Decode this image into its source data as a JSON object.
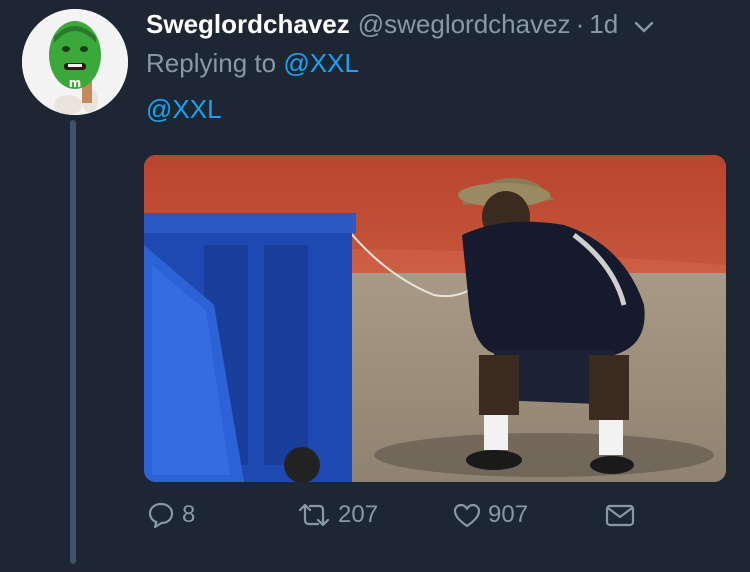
{
  "tweet": {
    "display_name": "Sweglordchavez",
    "handle": "@sweglordchavez",
    "separator": "·",
    "time": "1d",
    "replying_prefix": "Replying to",
    "replying_to": "@XXL",
    "text": "@XXL"
  },
  "actions": {
    "reply_count": "8",
    "retweet_count": "207",
    "like_count": "907"
  },
  "icons": {
    "caret": "chevron-down-icon",
    "reply": "reply-icon",
    "retweet": "retweet-icon",
    "like": "heart-icon",
    "dm": "envelope-icon"
  },
  "colors": {
    "background": "#1c2733",
    "link": "#1da1f2",
    "muted": "#8899a6",
    "thread_line": "#3d5466"
  }
}
